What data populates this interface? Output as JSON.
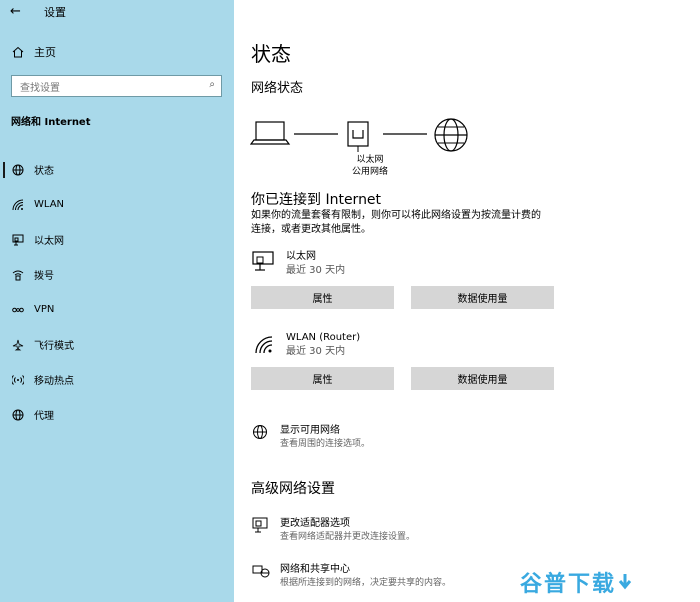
{
  "app": {
    "title": "设置",
    "back": "←"
  },
  "sidebar": {
    "home": "主页",
    "search_placeholder": "查找设置",
    "section": "网络和 Internet",
    "items": [
      {
        "label": "状态",
        "icon": "globe-icon"
      },
      {
        "label": "WLAN",
        "icon": "wifi-icon"
      },
      {
        "label": "以太网",
        "icon": "ethernet-icon"
      },
      {
        "label": "拨号",
        "icon": "dialup-icon"
      },
      {
        "label": "VPN",
        "icon": "vpn-icon"
      },
      {
        "label": "飞行模式",
        "icon": "airplane-icon"
      },
      {
        "label": "移动热点",
        "icon": "hotspot-icon"
      },
      {
        "label": "代理",
        "icon": "proxy-icon"
      }
    ]
  },
  "main": {
    "title": "状态",
    "network_status": "网络状态",
    "diagram": {
      "line1": "以太网",
      "line2": "公用网络"
    },
    "connected": "你已连接到 Internet",
    "description_line1": "如果你的流量套餐有限制，则你可以将此网络设置为按流量计费的",
    "description_line2": "连接，或者更改其他属性。",
    "connections": [
      {
        "name": "以太网",
        "sub": "最近 30 天内",
        "btn_props": "属性",
        "btn_data": "数据使用量"
      },
      {
        "name": "WLAN (Router)",
        "sub": "最近 30 天内",
        "btn_props": "属性",
        "btn_data": "数据使用量"
      }
    ],
    "show_networks": {
      "title": "显示可用网络",
      "sub": "查看周围的连接选项。"
    },
    "advanced": "高级网络设置",
    "adapter": {
      "title": "更改适配器选项",
      "sub": "查看网络适配器并更改连接设置。"
    },
    "sharing": {
      "title": "网络和共享中心",
      "sub": "根据所连接到的网络，决定要共享的内容。"
    }
  },
  "watermark": "谷普下载"
}
